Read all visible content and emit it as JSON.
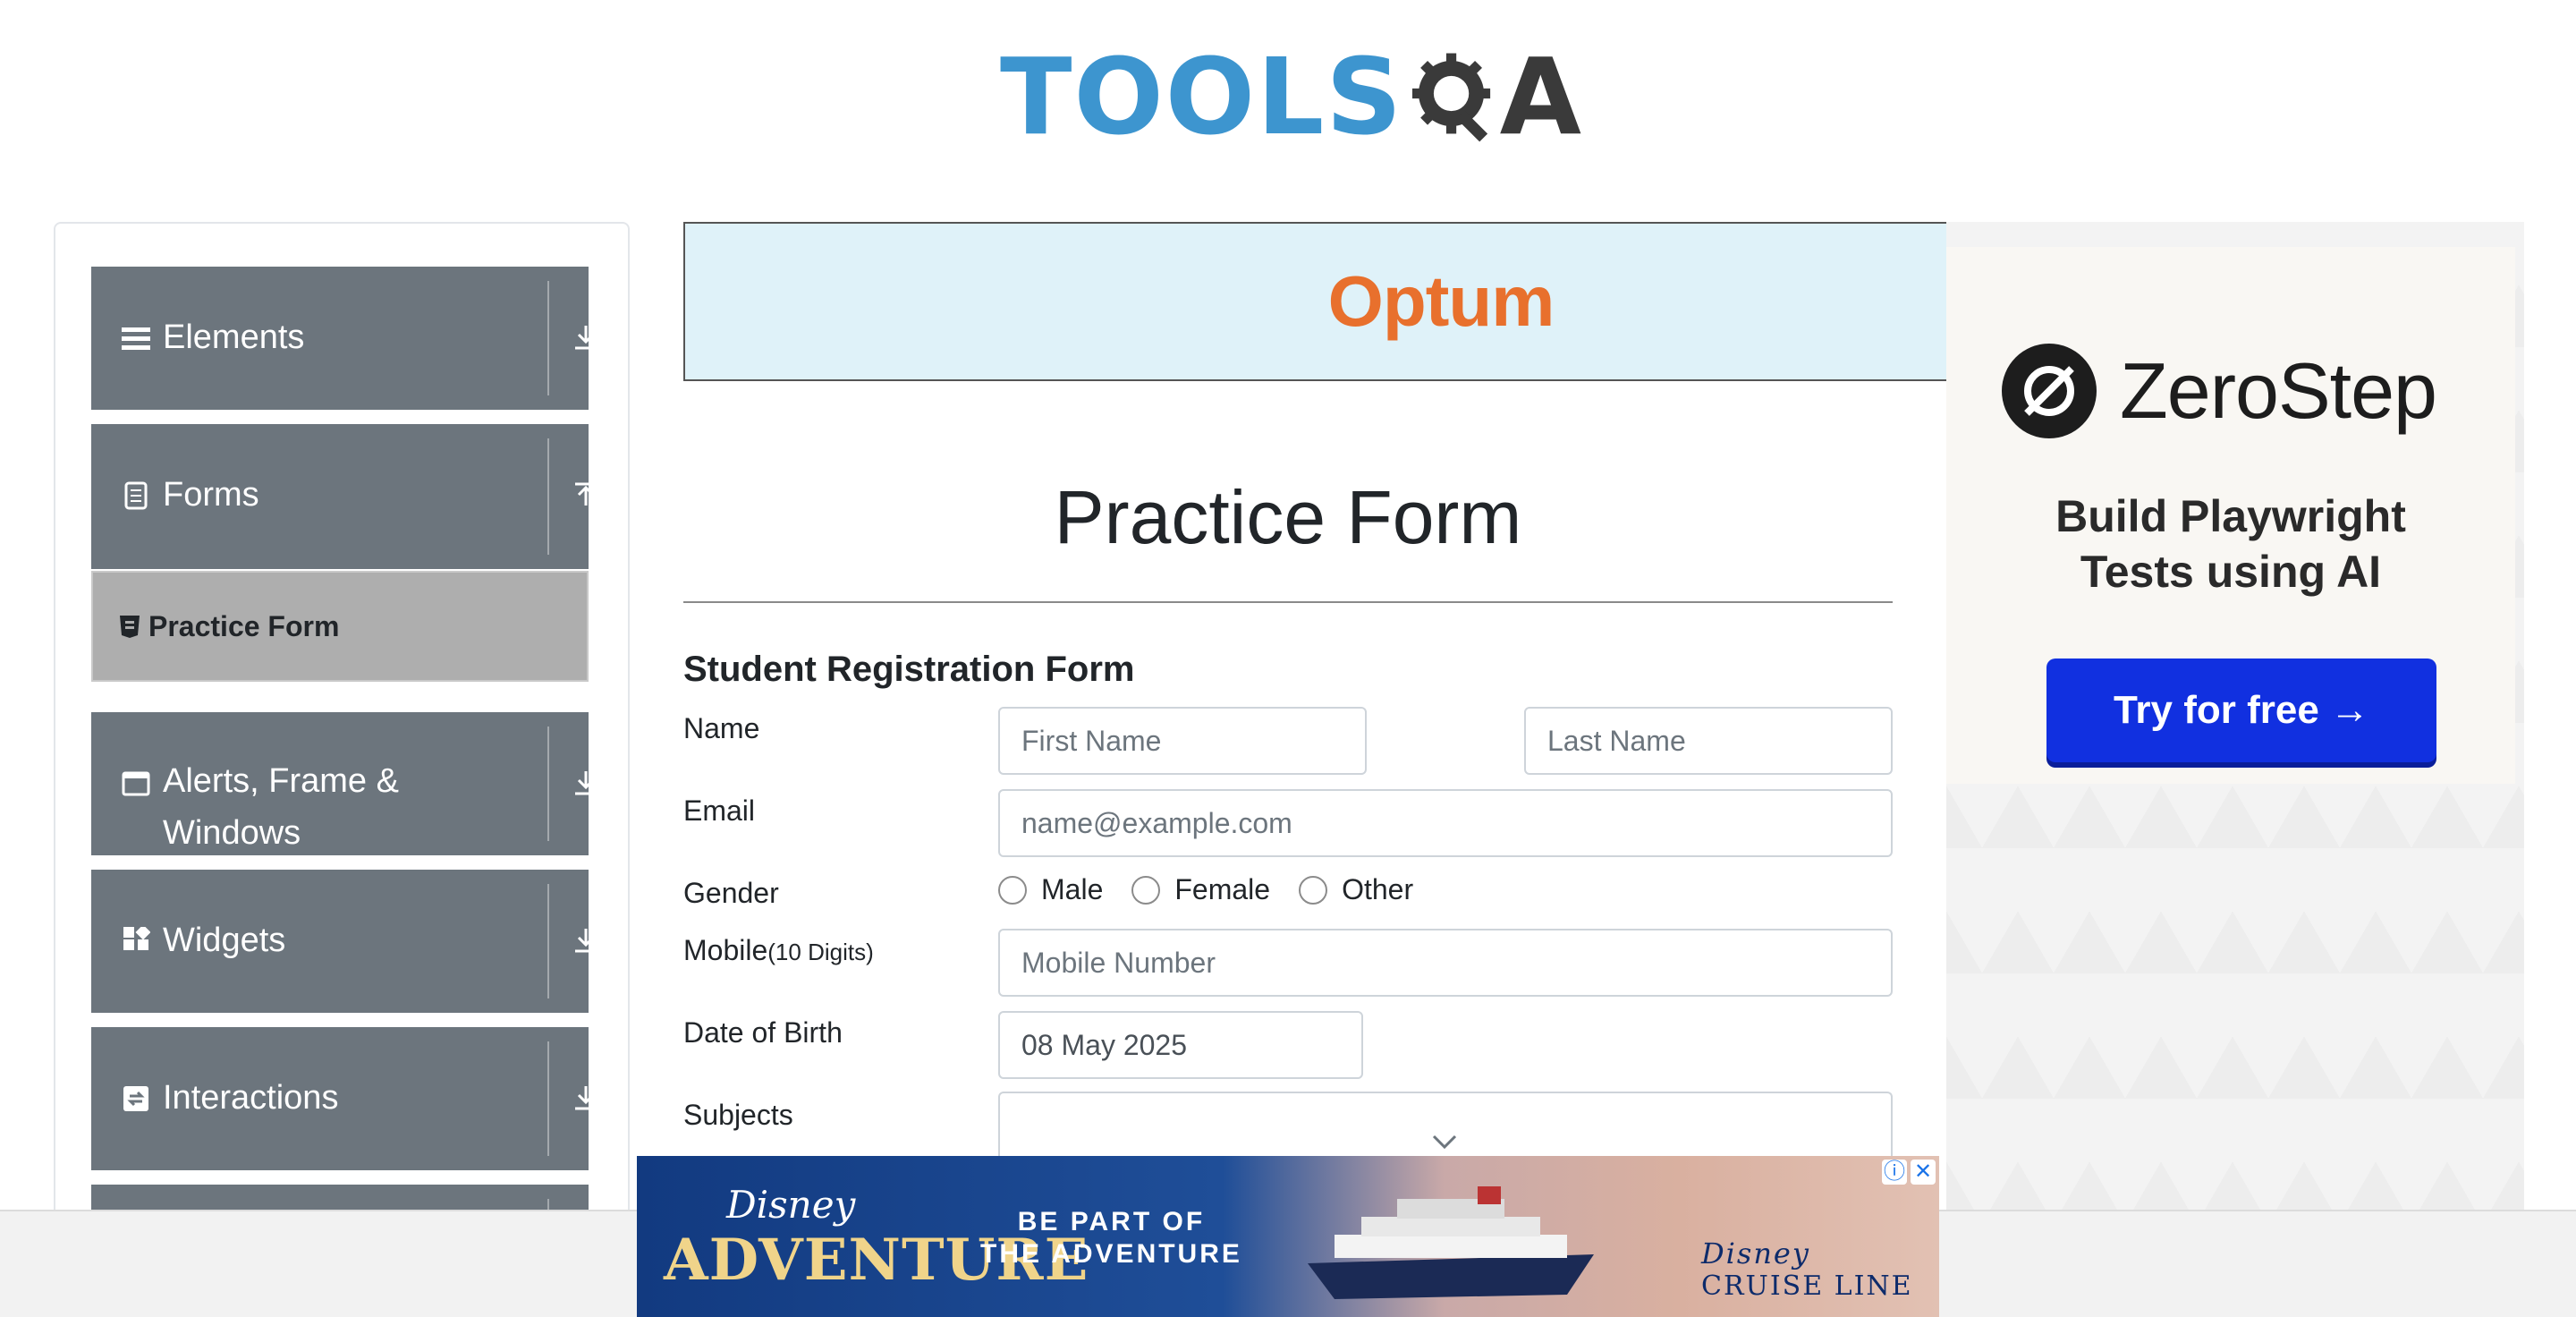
{
  "header": {
    "logo_text": "TOOLS",
    "logo_tail": "A"
  },
  "sidebar": {
    "groups": [
      {
        "label": "Elements",
        "icon": "hamburger-icon",
        "arrow": "download-arrow-icon"
      },
      {
        "label": "Forms",
        "icon": "form-icon",
        "arrow": "upload-arrow-icon"
      },
      {
        "label": "Alerts, Frame & Windows",
        "icon": "window-icon",
        "arrow": "download-arrow-icon"
      },
      {
        "label": "Widgets",
        "icon": "widgets-icon",
        "arrow": "download-arrow-icon"
      },
      {
        "label": "Interactions",
        "icon": "interactions-icon",
        "arrow": "download-arrow-icon"
      }
    ],
    "active_item": {
      "label": "Practice Form",
      "icon": "html-badge-icon"
    }
  },
  "banner_ad": {
    "brand": "Optum"
  },
  "form": {
    "title": "Practice Form",
    "subtitle": "Student Registration Form",
    "name_label": "Name",
    "first_name_placeholder": "First Name",
    "last_name_placeholder": "Last Name",
    "email_label": "Email",
    "email_placeholder": "name@example.com",
    "gender_label": "Gender",
    "gender_options": [
      "Male",
      "Female",
      "Other"
    ],
    "mobile_label": "Mobile",
    "mobile_hint": "(10 Digits)",
    "mobile_placeholder": "Mobile Number",
    "dob_label": "Date of Birth",
    "dob_value": "08 May 2025",
    "subjects_label": "Subjects"
  },
  "right_ad": {
    "brand": "ZeroStep",
    "tagline_line1": "Build Playwright",
    "tagline_line2": "Tests using AI",
    "cta": "Try for free →"
  },
  "bottom_ad": {
    "brand_top": "Disney",
    "brand_main": "ADVENTURE",
    "tagline_line1": "BE PART OF",
    "tagline_line2": "THE ADVENTURE",
    "cruise_brand": "Disney",
    "cruise_text": "CRUISE LINE"
  },
  "colors": {
    "sidebar_group_bg": "#6c757d",
    "active_item_bg": "#aeaeae",
    "logo_blue": "#3d95cf",
    "optum_orange": "#e8702d",
    "cta_blue": "#1130e0"
  }
}
